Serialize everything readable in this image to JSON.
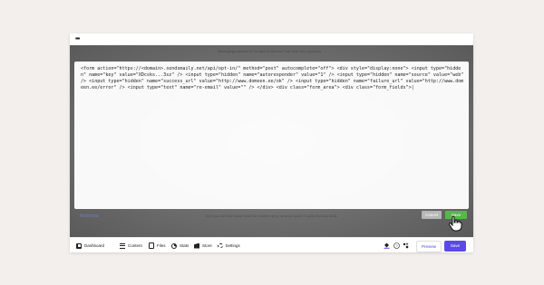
{
  "window": {
    "menu_icon": "more-dots-icon"
  },
  "background_page": {
    "top_text": "Belongings located in Dougherty Mauna, Kan was very spacious ...",
    "bottom_text_1": "And, you will find these near the northern end, at which point it splits into two ends.",
    "bottom_text_2": "..."
  },
  "code_editor": {
    "code": "<form action=\"https://<domain>.sendsmaily.net/api/opt-in/\" method=\"post\" autocomplete=\"off\">  <div style=\"display:none\">     <input type=\"hidden\" name=\"key\" value=\"XDcsks...3sz\" />    <input type=\"hidden\" name=\"autoresponder\" value=\"1\" />     <input type=\"hidden\" name=\"source\" value=\"web\" />     <input type=\"hidden\" name=\"success_url\" value=\"http://www.domeen.ee/ok\" />     <input type=\"hidden\" name=\"failure_url\" value=\"http://www.domeen.ee/error\" />    <input type=\"text\" name=\"re-email\" value=\"\" />  </div>  <div class=\"form_area\"> <div class=\"form_fields\">|",
    "reformat_label": "Reformat",
    "cancel_label": "Cancel",
    "save_label": "Save"
  },
  "bottom_nav": {
    "items": [
      {
        "label": "Dashboard",
        "icon": "dashboard-icon"
      },
      {
        "label": "Content",
        "icon": "content-icon"
      },
      {
        "label": "Files",
        "icon": "files-icon"
      },
      {
        "label": "Stats",
        "icon": "stats-icon"
      },
      {
        "label": "Store",
        "icon": "store-icon"
      },
      {
        "label": "Settings",
        "icon": "settings-icon"
      }
    ],
    "preview_label": "Preview",
    "save_label": "Save"
  },
  "colors": {
    "accent": "#5b4ae6",
    "save_green": "#54b948",
    "cancel_gray": "#b7b7b7"
  }
}
